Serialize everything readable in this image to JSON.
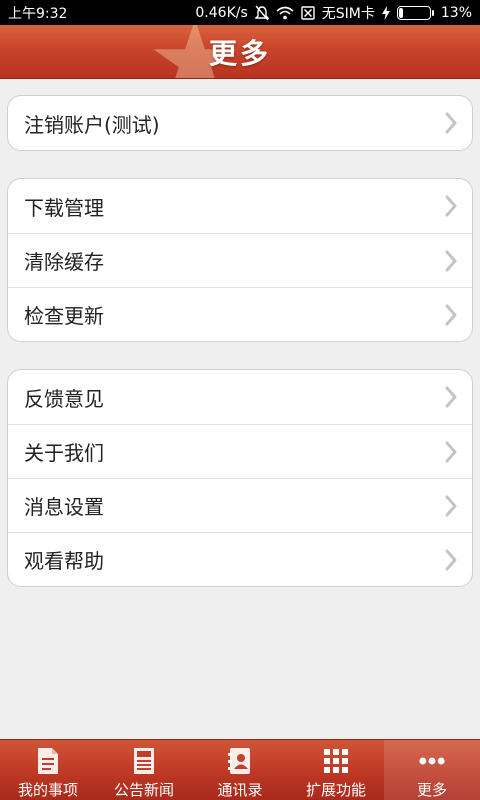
{
  "status_bar": {
    "time": "上午9:32",
    "network_speed": "0.46K/s",
    "sim": "无SIM卡",
    "battery": "13%",
    "battery_level": 0.13
  },
  "header": {
    "title": "更多"
  },
  "groups": [
    {
      "items": [
        {
          "label": "注销账户(测试)"
        }
      ]
    },
    {
      "items": [
        {
          "label": "下载管理"
        },
        {
          "label": "清除缓存"
        },
        {
          "label": "检查更新"
        }
      ]
    },
    {
      "items": [
        {
          "label": "反馈意见"
        },
        {
          "label": "关于我们"
        },
        {
          "label": "消息设置"
        },
        {
          "label": "观看帮助"
        }
      ]
    }
  ],
  "bottom_nav": {
    "active_index": 4,
    "items": [
      {
        "label": "我的事项",
        "icon": "document-icon"
      },
      {
        "label": "公告新闻",
        "icon": "newspaper-icon"
      },
      {
        "label": "通讯录",
        "icon": "contacts-icon"
      },
      {
        "label": "扩展功能",
        "icon": "grid-icon"
      },
      {
        "label": "更多",
        "icon": "more-dots-icon"
      }
    ]
  }
}
